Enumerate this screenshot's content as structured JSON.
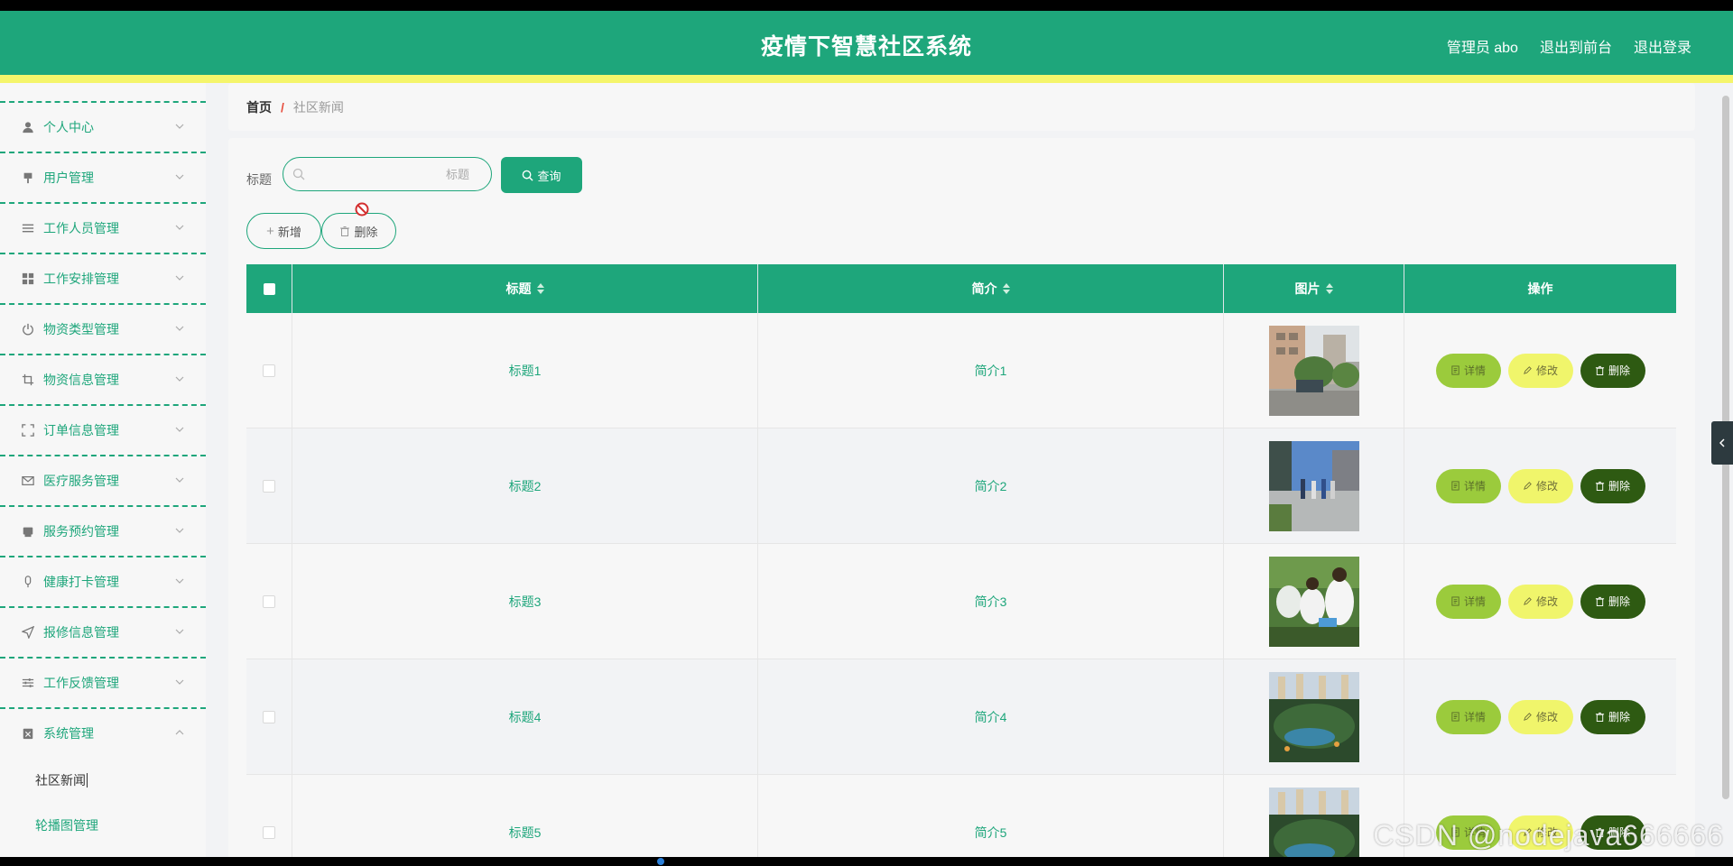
{
  "header": {
    "title": "疫情下智慧社区系统",
    "user": "管理员 abo",
    "to_front": "退出到前台",
    "logout": "退出登录"
  },
  "sidebar": {
    "items": [
      {
        "label": "个人中心",
        "icon": "user-icon"
      },
      {
        "label": "用户管理",
        "icon": "pin-icon"
      },
      {
        "label": "工作人员管理",
        "icon": "list-icon"
      },
      {
        "label": "工作安排管理",
        "icon": "grid-icon"
      },
      {
        "label": "物资类型管理",
        "icon": "power-icon"
      },
      {
        "label": "物资信息管理",
        "icon": "crop-icon"
      },
      {
        "label": "订单信息管理",
        "icon": "fullscreen-icon"
      },
      {
        "label": "医疗服务管理",
        "icon": "mail-icon"
      },
      {
        "label": "服务预约管理",
        "icon": "printer-icon"
      },
      {
        "label": "健康打卡管理",
        "icon": "microphone-icon"
      },
      {
        "label": "报修信息管理",
        "icon": "navigation-icon"
      },
      {
        "label": "工作反馈管理",
        "icon": "sliders-icon"
      },
      {
        "label": "系统管理",
        "icon": "clipboard-icon"
      }
    ],
    "submenu": [
      "社区新闻",
      "轮播图管理"
    ]
  },
  "breadcrumb": {
    "home": "首页",
    "sep": "/",
    "current": "社区新闻"
  },
  "search": {
    "label": "标题",
    "placeholder": "标题",
    "button": "查询"
  },
  "actions": {
    "add": "新增",
    "delete": "删除"
  },
  "table": {
    "columns": [
      "标题",
      "简介",
      "图片",
      "操作"
    ],
    "rows": [
      {
        "title": "标题1",
        "intro": "简介1"
      },
      {
        "title": "标题2",
        "intro": "简介2"
      },
      {
        "title": "标题3",
        "intro": "简介3"
      },
      {
        "title": "标题4",
        "intro": "简介4"
      },
      {
        "title": "标题5",
        "intro": "简介5"
      }
    ],
    "ops": {
      "detail": "详情",
      "edit": "修改",
      "delete": "删除"
    }
  },
  "watermark": "CSDN @nodejava666666",
  "colors": {
    "primary": "#1ea67b",
    "accent_bar": "#f5f56b",
    "detail": "#9bcb3c",
    "edit": "#f0f56b",
    "danger": "#2e5a12"
  }
}
